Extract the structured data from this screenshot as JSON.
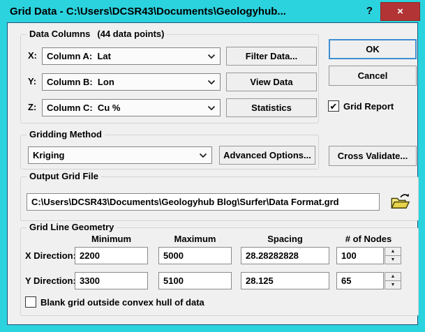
{
  "window": {
    "title": "Grid Data - C:\\Users\\DCSR43\\Documents\\Geologyhub...",
    "help": "?",
    "close": "×"
  },
  "icons": {
    "check": "✔",
    "up": "▲",
    "down": "▼"
  },
  "colors": {
    "frame_cyan": "#2bd3de",
    "close_red": "#b23434",
    "client_bg": "#f0f0f0",
    "default_button_border": "#3f8fd2",
    "folder_yellow": "#e8d24a"
  },
  "data_columns": {
    "legend": "Data Columns",
    "points": "(44 data points)",
    "x_label": "X:",
    "y_label": "Y:",
    "z_label": "Z:",
    "x_value": "Column A:  Lat",
    "y_value": "Column B:  Lon",
    "z_value": "Column C:  Cu %",
    "filter_button": "Filter Data...",
    "view_button": "View Data",
    "statistics_button": "Statistics"
  },
  "actions": {
    "ok": "OK",
    "cancel": "Cancel",
    "grid_report": "Grid Report",
    "cross_validate": "Cross Validate..."
  },
  "gridding_method": {
    "legend": "Gridding Method",
    "value": "Kriging",
    "advanced_button": "Advanced Options..."
  },
  "output_grid_file": {
    "legend": "Output Grid File",
    "path": "C:\\Users\\DCSR43\\Documents\\Geologyhub Blog\\Surfer\\Data Format.grd"
  },
  "grid_geometry": {
    "legend": "Grid Line Geometry",
    "headers": {
      "minimum": "Minimum",
      "maximum": "Maximum",
      "spacing": "Spacing",
      "nodes": "# of Nodes"
    },
    "x_label": "X Direction:",
    "y_label": "Y Direction:",
    "x_min": "2200",
    "x_max": "5000",
    "x_spacing": "28.28282828",
    "x_nodes": "100",
    "y_min": "3300",
    "y_max": "5100",
    "y_spacing": "28.125",
    "y_nodes": "65",
    "blank_hull": "Blank grid outside convex hull of data"
  }
}
